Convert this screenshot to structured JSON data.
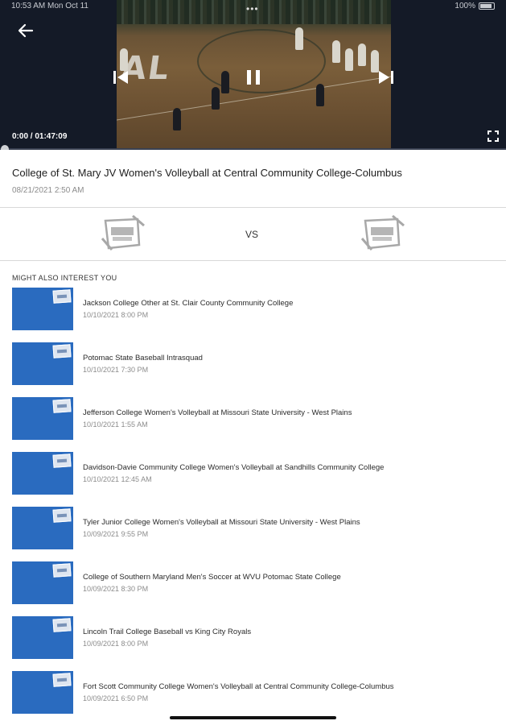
{
  "status_bar": {
    "left_text": "10:53 AM   Mon Oct 11",
    "right_text": "100%"
  },
  "player": {
    "court_text": "AL",
    "more_dots": "•••",
    "time_readout": "0:00 / 01:47:09",
    "progress_fraction": 0.0
  },
  "event": {
    "title": "College of St. Mary JV Women's Volleyball at Central Community College-Columbus",
    "date": "08/21/2021 2:50 AM"
  },
  "matchup": {
    "vs_label": "VS"
  },
  "related": {
    "heading": "MIGHT ALSO INTEREST YOU",
    "items": [
      {
        "title": "Jackson College Other at St. Clair County Community College",
        "date": "10/10/2021 8:00 PM"
      },
      {
        "title": "Potomac State Baseball Intrasquad",
        "date": "10/10/2021 7:30 PM"
      },
      {
        "title": "Jefferson College Women's Volleyball at Missouri State University - West Plains",
        "date": "10/10/2021 1:55 AM"
      },
      {
        "title": "Davidson-Davie Community College Women's Volleyball at Sandhills Community College",
        "date": "10/10/2021 12:45 AM"
      },
      {
        "title": "Tyler Junior College Women's Volleyball at Missouri State University - West Plains",
        "date": "10/09/2021 9:55 PM"
      },
      {
        "title": "College of Southern Maryland Men's Soccer at WVU Potomac State College",
        "date": "10/09/2021 8:30 PM"
      },
      {
        "title": "Lincoln Trail College Baseball vs King City Royals",
        "date": "10/09/2021 8:00 PM"
      },
      {
        "title": "Fort Scott Community College Women's Volleyball at Central Community College-Columbus",
        "date": "10/09/2021 6:50 PM"
      }
    ]
  },
  "colors": {
    "player_bg": "#141a27",
    "thumb_blue": "#2a6bbf",
    "divider": "#d8d8d8"
  }
}
